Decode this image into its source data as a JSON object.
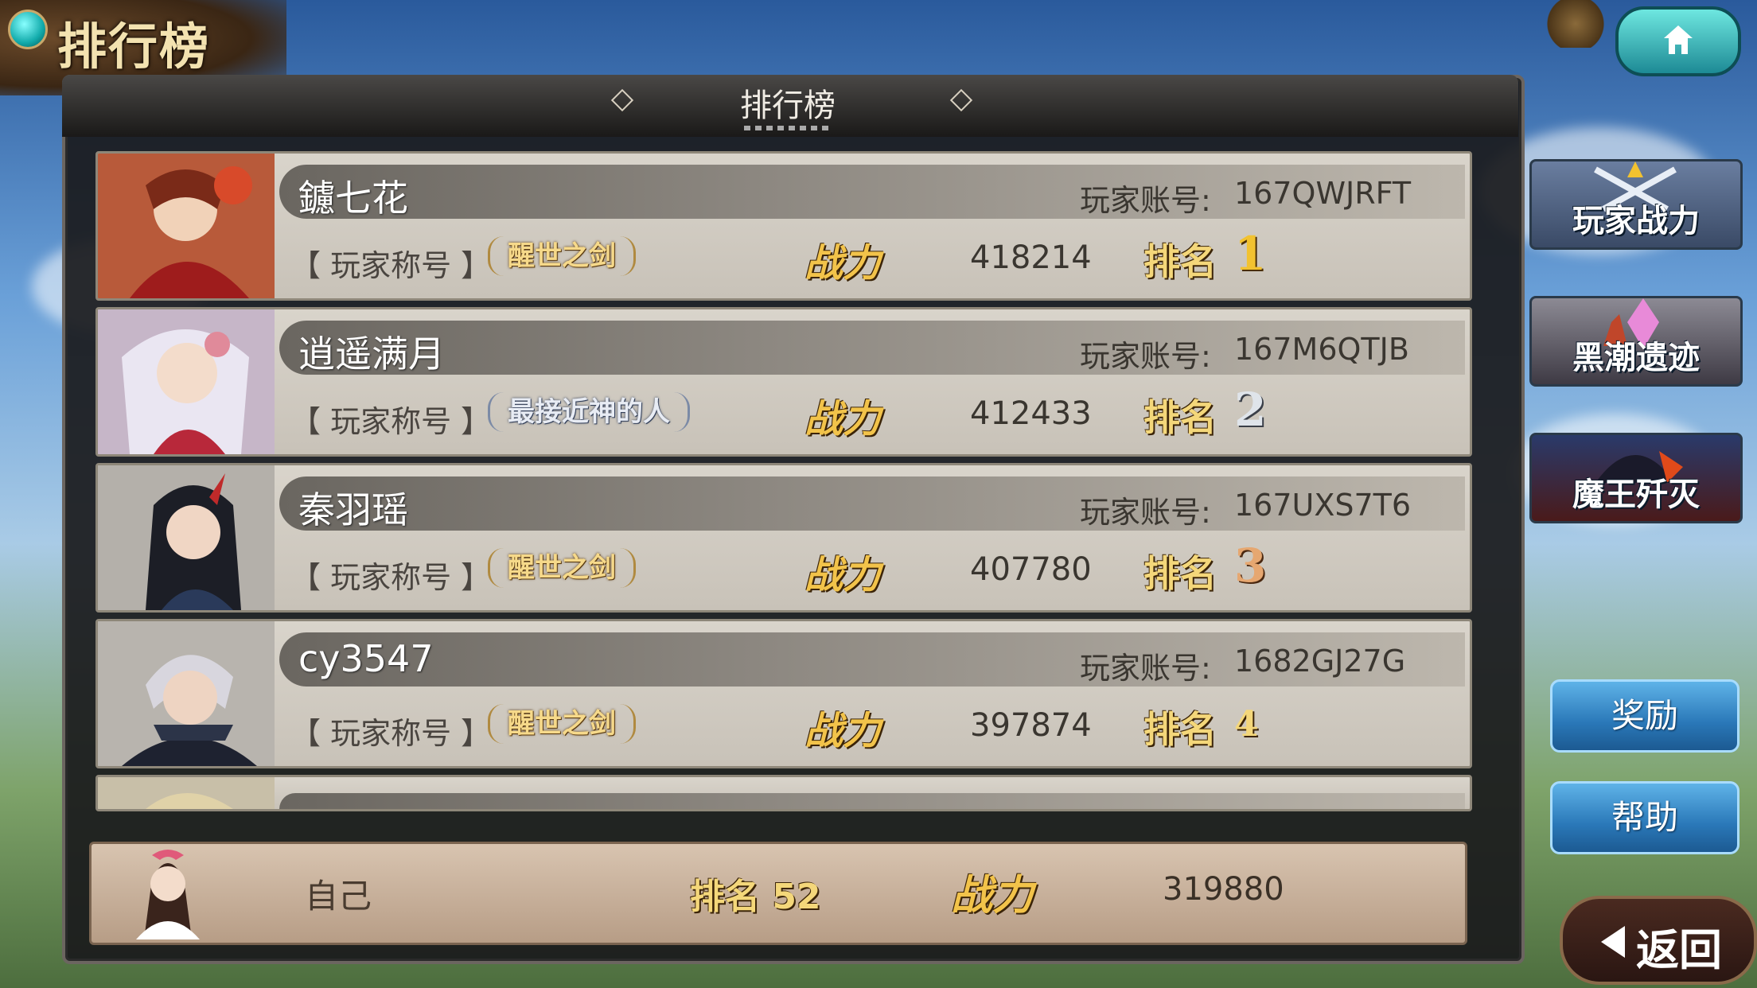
{
  "header": {
    "page_title": "排行榜",
    "panel_title": "排行榜"
  },
  "labels": {
    "account": "玩家账号:",
    "title_tag": "【 玩家称号 】",
    "power": "战力",
    "rank": "排名"
  },
  "rows": [
    {
      "name": "鑢七花",
      "account": "167QWJRFT",
      "badge": "醒世之剑",
      "power": "418214",
      "rank": "1"
    },
    {
      "name": "逍遥满月",
      "account": "167M6QTJB",
      "badge": "最接近神的人",
      "power": "412433",
      "rank": "2"
    },
    {
      "name": "秦羽瑶",
      "account": "167UXS7T6",
      "badge": "醒世之剑",
      "power": "407780",
      "rank": "3"
    },
    {
      "name": "cy3547",
      "account": "1682GJ27G",
      "badge": "醒世之剑",
      "power": "397874",
      "rank": "4"
    }
  ],
  "self": {
    "label": "自己",
    "rank": "排名 52",
    "power_label": "战力",
    "power": "319880"
  },
  "side_tabs": [
    "玩家战力",
    "黑潮遗迹",
    "魔王歼灭"
  ],
  "buttons": {
    "reward": "奖励",
    "help": "帮助",
    "back": "返回"
  },
  "colors": {
    "rank_gold": "#f2c230",
    "rank_silver": "#dfe4ea",
    "rank_bronze": "#e6a770",
    "power_label": "#f2c34a"
  }
}
